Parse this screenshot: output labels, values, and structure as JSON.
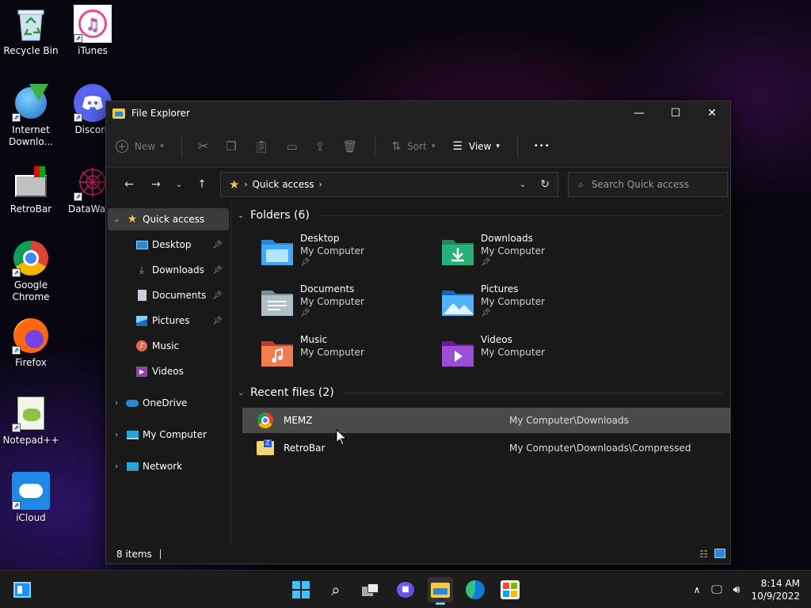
{
  "desktop": {
    "icons": [
      {
        "label": "Recycle Bin"
      },
      {
        "label": "iTunes"
      },
      {
        "label": "Internet Downlo..."
      },
      {
        "label": "Discord"
      },
      {
        "label": "RetroBar"
      },
      {
        "label": "DataWago"
      },
      {
        "label": "Google Chrome"
      },
      {
        "label": "Firefox"
      },
      {
        "label": "Notepad++"
      },
      {
        "label": "iCloud"
      }
    ]
  },
  "window": {
    "title": "File Explorer",
    "controls": {
      "minimize": "—",
      "maximize": "☐",
      "close": "✕"
    },
    "toolbar": {
      "new_label": "New",
      "sort_label": "Sort",
      "view_label": "View",
      "more_label": "•••"
    },
    "address": {
      "crumb": "Quick access",
      "search_placeholder": "Search Quick access"
    },
    "sidebar": {
      "items": [
        {
          "label": "Quick access"
        },
        {
          "label": "Desktop"
        },
        {
          "label": "Downloads"
        },
        {
          "label": "Documents"
        },
        {
          "label": "Pictures"
        },
        {
          "label": "Music"
        },
        {
          "label": "Videos"
        },
        {
          "label": "OneDrive"
        },
        {
          "label": "My Computer"
        },
        {
          "label": "Network"
        }
      ]
    },
    "folders_header": "Folders (6)",
    "folders": [
      {
        "name": "Desktop",
        "location": "My Computer"
      },
      {
        "name": "Downloads",
        "location": "My Computer"
      },
      {
        "name": "Documents",
        "location": "My Computer"
      },
      {
        "name": "Pictures",
        "location": "My Computer"
      },
      {
        "name": "Music",
        "location": "My Computer"
      },
      {
        "name": "Videos",
        "location": "My Computer"
      }
    ],
    "recent_header": "Recent files (2)",
    "recent_files": [
      {
        "name": "MEMZ",
        "path": "My Computer\\Downloads"
      },
      {
        "name": "RetroBar",
        "path": "My Computer\\Downloads\\Compressed"
      }
    ],
    "status": {
      "items": "8 items"
    }
  },
  "taskbar": {
    "time": "8:14 AM",
    "date": "10/9/2022"
  },
  "colors": {
    "accent": "#60cdff",
    "window_bg": "#191919",
    "hover_row": "#4a4a4a",
    "folder_yellow": "#f2c94c"
  }
}
